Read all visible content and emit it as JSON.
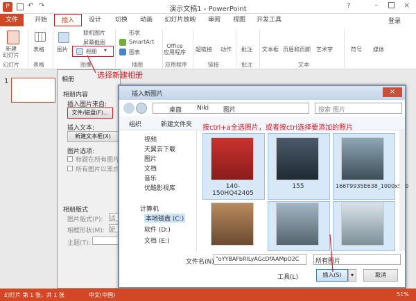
{
  "window": {
    "title": "演示文稿1 - PowerPoint",
    "login": "登录"
  },
  "tabs": [
    "文件",
    "开始",
    "插入",
    "设计",
    "切换",
    "动画",
    "幻灯片放映",
    "审阅",
    "视图",
    "开发工具"
  ],
  "ribbon": {
    "new_slide": "新建\n幻灯片",
    "table": "表格",
    "picture": "图片",
    "online_picture": "联机图片",
    "screenshot": "屏幕截图",
    "album": "相册",
    "shapes": "形状",
    "smartart": "SmartArt",
    "chart": "图表",
    "office_apps": "Office\n应用程序",
    "hyperlink": "超链接",
    "action": "动作",
    "comment": "批注",
    "textbox": "文本框",
    "header_footer": "页眉和页脚",
    "wordart": "艺术字",
    "symbol": "符号",
    "media": "媒体",
    "groups": {
      "slides": "幻灯片",
      "tables": "表格",
      "images": "图像",
      "illustrations": "插图",
      "apps": "应用程序",
      "links": "链接",
      "comments": "批注",
      "text": "文本"
    }
  },
  "annotations": {
    "album_hint": "选择新建相册",
    "select_hint": "按ctrl+a全选照片，或者按ctrl选择要添加的照片"
  },
  "album_dialog": {
    "title": "相册",
    "content_label": "相册内容",
    "insert_from": "插入图片来自:",
    "file_disk_btn": "文件/磁盘(F)...",
    "insert_text": "插入文本:",
    "new_textbox_btn": "新建文本框(X)",
    "picture_options": "图片选项:",
    "opt_caption": "标题在所有图片",
    "opt_bw": "所有图片以黑白",
    "layout_label": "相册版式",
    "picture_layout": "图片版式(P):",
    "frame_shape": "相框形状(M):",
    "theme": "主题(T):",
    "layout_val": "适",
    "frame_val": "矩",
    "slide_number": "1"
  },
  "insert_dialog": {
    "title": "插入新图片",
    "path": [
      "桌面",
      "Niki",
      "图片"
    ],
    "search_placeholder": "搜索 图片",
    "organize": "组织",
    "new_folder": "新建文件夹",
    "nav": [
      "视频",
      "天翼云下载",
      "图片",
      "文档",
      "音乐",
      "优酷影视库",
      "计算机",
      "本地磁盘 (C:)",
      "软件 (D:)",
      "文档 (E:)"
    ],
    "files": [
      "140-150HQ42405",
      "155",
      "166T9935E638_1000x500",
      "",
      "",
      ""
    ],
    "filename_label": "文件名(N):",
    "filename_value": "\"oYYBAFbRILyAGcDfAAMpO2C",
    "filetype": "所有图片",
    "tools": "工具(L)",
    "insert_btn": "插入(S)",
    "cancel_btn": "取消"
  },
  "status": {
    "slide_info": "幻灯片 第 1 张，共 1 张",
    "lang": "中文(中国)",
    "zoom": "51%"
  },
  "colors": {
    "accent": "#d24726",
    "annotation": "#e8131e"
  }
}
